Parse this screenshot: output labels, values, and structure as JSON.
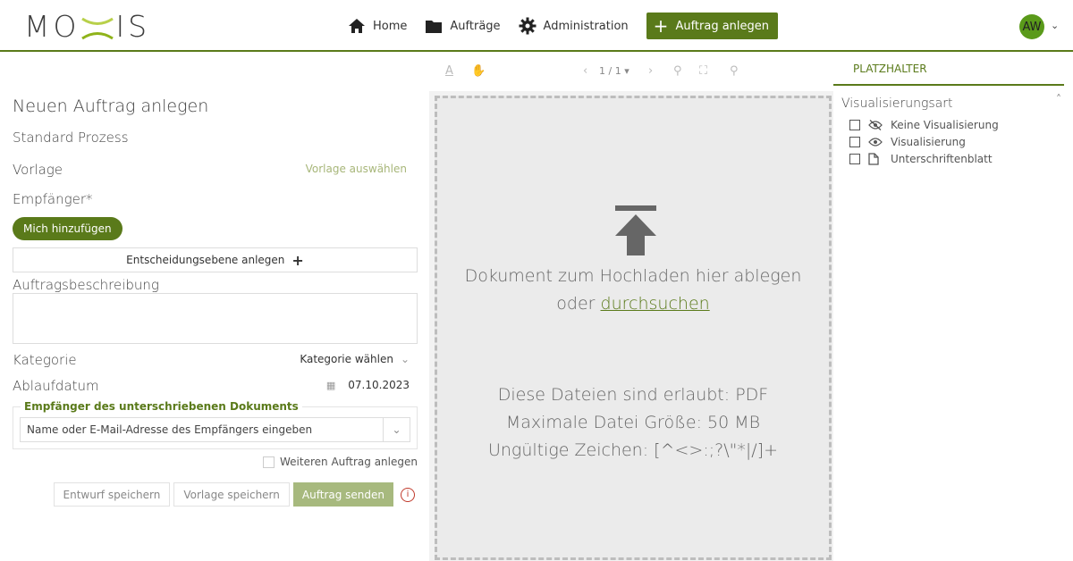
{
  "header": {
    "logo": "MOXIS",
    "nav": [
      {
        "label": "Home",
        "icon": "home-icon"
      },
      {
        "label": "Aufträge",
        "icon": "folder-icon"
      },
      {
        "label": "Administration",
        "icon": "gear-icon"
      }
    ],
    "create_label": "Auftrag anlegen",
    "avatar_initials": "AW"
  },
  "form": {
    "title": "Neuen Auftrag anlegen",
    "subtitle": "Standard Prozess",
    "vorlage_label": "Vorlage",
    "vorlage_link": "Vorlage auswählen",
    "empfaenger_label": "Empfänger*",
    "mich_label": "Mich hinzufügen",
    "ebene_label": "Entscheidungsebene anlegen",
    "beschreibung_label": "Auftragsbeschreibung",
    "kategorie_label": "Kategorie",
    "kategorie_value": "Kategorie wählen",
    "ablauf_label": "Ablaufdatum",
    "ablauf_value": "07.10.2023",
    "recipients_legend": "Empfänger des unterschriebenen Dokuments",
    "email_placeholder": "Name oder E-Mail-Adresse des Empfängers eingeben",
    "weiteren_label": "Weiteren Auftrag anlegen",
    "entwurf_label": "Entwurf speichern",
    "vorlage_speichern_label": "Vorlage speichern",
    "senden_label": "Auftrag senden"
  },
  "viewer": {
    "page_indicator": "1 / 1",
    "drop_line1": "Dokument zum Hochladen hier ablegen",
    "drop_line2_prefix": "oder",
    "drop_link": "durchsuchen",
    "allowed": "Diese Dateien sind erlaubt: PDF",
    "max_size": "Maximale Datei Größe: 50 MB",
    "invalid_chars": "Ungültige Zeichen: [^<>:;?\\\"*|/]+"
  },
  "panel": {
    "tab": "PLATZHALTER",
    "section_title": "Visualisierungsart",
    "options": [
      {
        "label": "Keine Visualisierung",
        "icon": "eye-slash-icon"
      },
      {
        "label": "Visualisierung",
        "icon": "eye-icon"
      },
      {
        "label": "Unterschriftenblatt",
        "icon": "file-icon"
      }
    ]
  },
  "colors": {
    "brand": "#5a7a1a",
    "brand_light": "#a7b97e",
    "error": "#c0392b"
  }
}
